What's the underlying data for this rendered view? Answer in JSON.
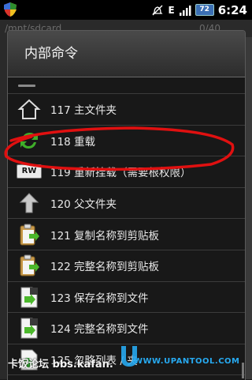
{
  "status_bar": {
    "time": "6:24",
    "battery": "72",
    "network": "E",
    "icons": [
      "app-shield-icon",
      "alarm-off-icon",
      "signal-icon",
      "battery-icon"
    ]
  },
  "background": {
    "path": "/mnt/sdcard",
    "count": "0/40"
  },
  "dialog": {
    "title": "内部命令",
    "items": [
      {
        "label": "117 主文件夹",
        "icon": "home-outline-icon"
      },
      {
        "label": "118 重载",
        "icon": "green-refresh-icon"
      },
      {
        "label": "119 重新挂载（需要根权限）",
        "icon": "rw-badge-icon"
      },
      {
        "label": "120 父文件夹",
        "icon": "up-arrow-icon"
      },
      {
        "label": "121 复制名称到剪贴板",
        "icon": "clipboard-copy-icon"
      },
      {
        "label": "122 完整名称到剪贴板",
        "icon": "clipboard-copy-icon"
      },
      {
        "label": "123 保存名称到文件",
        "icon": "save-to-file-icon"
      },
      {
        "label": "124 完整名称到文件",
        "icon": "save-to-file-icon"
      },
      {
        "label": "125 忽略列表 / 夹",
        "icon": "ignore-list-icon"
      }
    ],
    "rw_text": "RW"
  },
  "watermark": {
    "left": "卡饭论坛 bbs.kafan.",
    "right": "WWW.UPANTOOL.COM"
  },
  "colors": {
    "annotation": "#e01010",
    "accent_green": "#3fae2a"
  }
}
